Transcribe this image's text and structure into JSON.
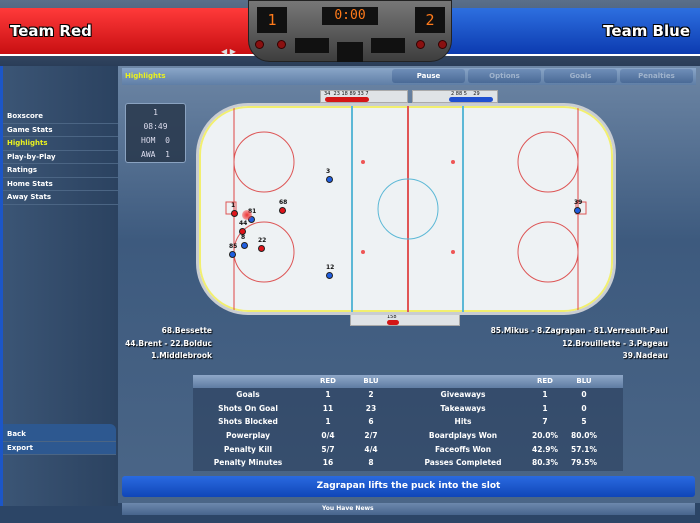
{
  "header": {
    "home_team": "Team Red",
    "away_team": "Team Blue",
    "home_score": "1",
    "away_score": "2",
    "clock": "0:00"
  },
  "sidebar": {
    "items": [
      {
        "label": "Boxscore"
      },
      {
        "label": "Game Stats"
      },
      {
        "label": "Highlights",
        "active": true
      },
      {
        "label": "Play-by-Play"
      },
      {
        "label": "Ratings"
      },
      {
        "label": "Home Stats"
      },
      {
        "label": "Away Stats"
      }
    ],
    "bottom": [
      {
        "label": "Back"
      },
      {
        "label": "Export"
      }
    ]
  },
  "panel": {
    "title": "Highlights",
    "tabs": [
      {
        "label": "Pause"
      },
      {
        "label": "Options"
      },
      {
        "label": "Goals"
      },
      {
        "label": "Penalties"
      }
    ]
  },
  "game_clock": {
    "period": "1",
    "time": "08:49",
    "home": "HOM  0",
    "away": "AWA  1"
  },
  "players": [
    {
      "num": "1",
      "team": "red"
    },
    {
      "num": "68",
      "team": "red"
    },
    {
      "num": "81",
      "team": "blue"
    },
    {
      "num": "44",
      "team": "red"
    },
    {
      "num": "8",
      "team": "blue"
    },
    {
      "num": "85",
      "team": "blue"
    },
    {
      "num": "22",
      "team": "red"
    },
    {
      "num": "3",
      "team": "blue"
    },
    {
      "num": "12",
      "team": "blue"
    },
    {
      "num": "39",
      "team": "blue"
    }
  ],
  "benches": {
    "red_top": "34  23 18 89 33 7",
    "blue_top": "2 88 5    29",
    "penalty": "158"
  },
  "lines": {
    "red": [
      "68.Bessette",
      "44.Brent - 22.Bolduc",
      "1.Middlebrook"
    ],
    "blue": [
      "85.Mikus - 8.Zagrapan - 81.Verreault-Paul",
      "12.Brouillette - 3.Pageau",
      "39.Nadeau"
    ]
  },
  "stats": {
    "headers": [
      "RED",
      "BLU"
    ],
    "left": [
      [
        "Goals",
        "1",
        "2"
      ],
      [
        "Shots On Goal",
        "11",
        "23"
      ],
      [
        "Shots Blocked",
        "1",
        "6"
      ],
      [
        "Powerplay",
        "0/4",
        "2/7"
      ],
      [
        "Penalty Kill",
        "5/7",
        "4/4"
      ],
      [
        "Penalty Minutes",
        "16",
        "8"
      ]
    ],
    "right": [
      [
        "Giveaways",
        "1",
        "0"
      ],
      [
        "Takeaways",
        "1",
        "0"
      ],
      [
        "Hits",
        "7",
        "5"
      ],
      [
        "Boardplays Won",
        "20.0%",
        "80.0%"
      ],
      [
        "Faceoffs Won",
        "42.9%",
        "57.1%"
      ],
      [
        "Passes Completed",
        "80.3%",
        "79.5%"
      ]
    ]
  },
  "message": "Zagrapan lifts the puck into the slot",
  "news": "You Have News",
  "colors": {
    "red": "#e0141a",
    "blue": "#1f5ee0",
    "highlight": "#e8f020"
  }
}
